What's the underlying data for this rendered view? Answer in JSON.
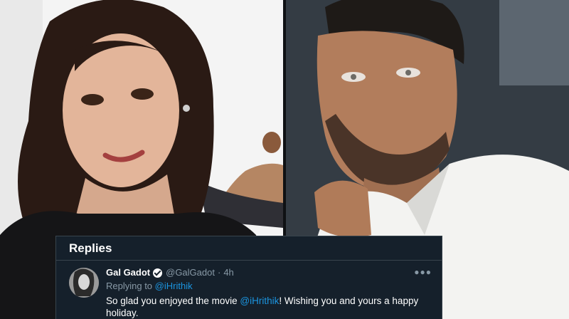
{
  "replies": {
    "header": "Replies",
    "tweet": {
      "author_name": "Gal Gadot",
      "handle": "@GalGadot",
      "separator": "·",
      "time": "4h",
      "more_icon": "more-horizontal-icon",
      "replying_prefix": "Replying to",
      "replying_to": "@iHrithik",
      "text_before": "So glad you enjoyed the movie ",
      "mention": "@iHrithik",
      "text_after": "! Wishing you and yours a happy holiday."
    }
  },
  "colors": {
    "card_background": "#15202b",
    "border": "#38444d",
    "link": "#1b95e0",
    "muted_text": "#8899a6",
    "primary_text": "#ffffff"
  }
}
